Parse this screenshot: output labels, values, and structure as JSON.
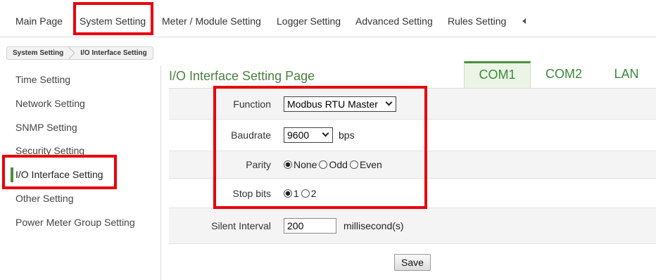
{
  "nav": {
    "items": [
      {
        "label": "Main Page"
      },
      {
        "label": "System Setting"
      },
      {
        "label": "Meter / Module Setting"
      },
      {
        "label": "Logger Setting"
      },
      {
        "label": "Advanced Setting"
      },
      {
        "label": "Rules Setting"
      }
    ],
    "scroll_icon": "triangle-left-icon"
  },
  "breadcrumb": [
    "System Setting",
    "I/O Interface Setting"
  ],
  "sidebar": {
    "items": [
      "Time Setting",
      "Network Setting",
      "SNMP Setting",
      "Security Setting",
      "I/O Interface Setting",
      "Other Setting",
      "Power Meter Group Setting"
    ],
    "active_index": 4
  },
  "page_title": "I/O Interface Setting Page",
  "tabs": {
    "items": [
      "COM1",
      "COM2",
      "LAN"
    ],
    "active_index": 0
  },
  "form": {
    "function": {
      "label": "Function",
      "value": "Modbus RTU Master"
    },
    "baudrate": {
      "label": "Baudrate",
      "value": "9600",
      "unit": "bps"
    },
    "parity": {
      "label": "Parity",
      "options": [
        "None",
        "Odd",
        "Even"
      ],
      "selected_index": 0
    },
    "stop_bits": {
      "label": "Stop bits",
      "options": [
        "1",
        "2"
      ],
      "selected_index": 0
    },
    "silent_interval": {
      "label": "Silent Interval",
      "value": "200",
      "unit": "millisecond(s)"
    },
    "save_label": "Save"
  },
  "colors": {
    "accent_green": "#4c8f3c",
    "tab_text": "#3a8a3a",
    "title_text": "#4b8040",
    "active_tab_bg": "#ecf4e6",
    "highlight_red": "#e8000b"
  }
}
